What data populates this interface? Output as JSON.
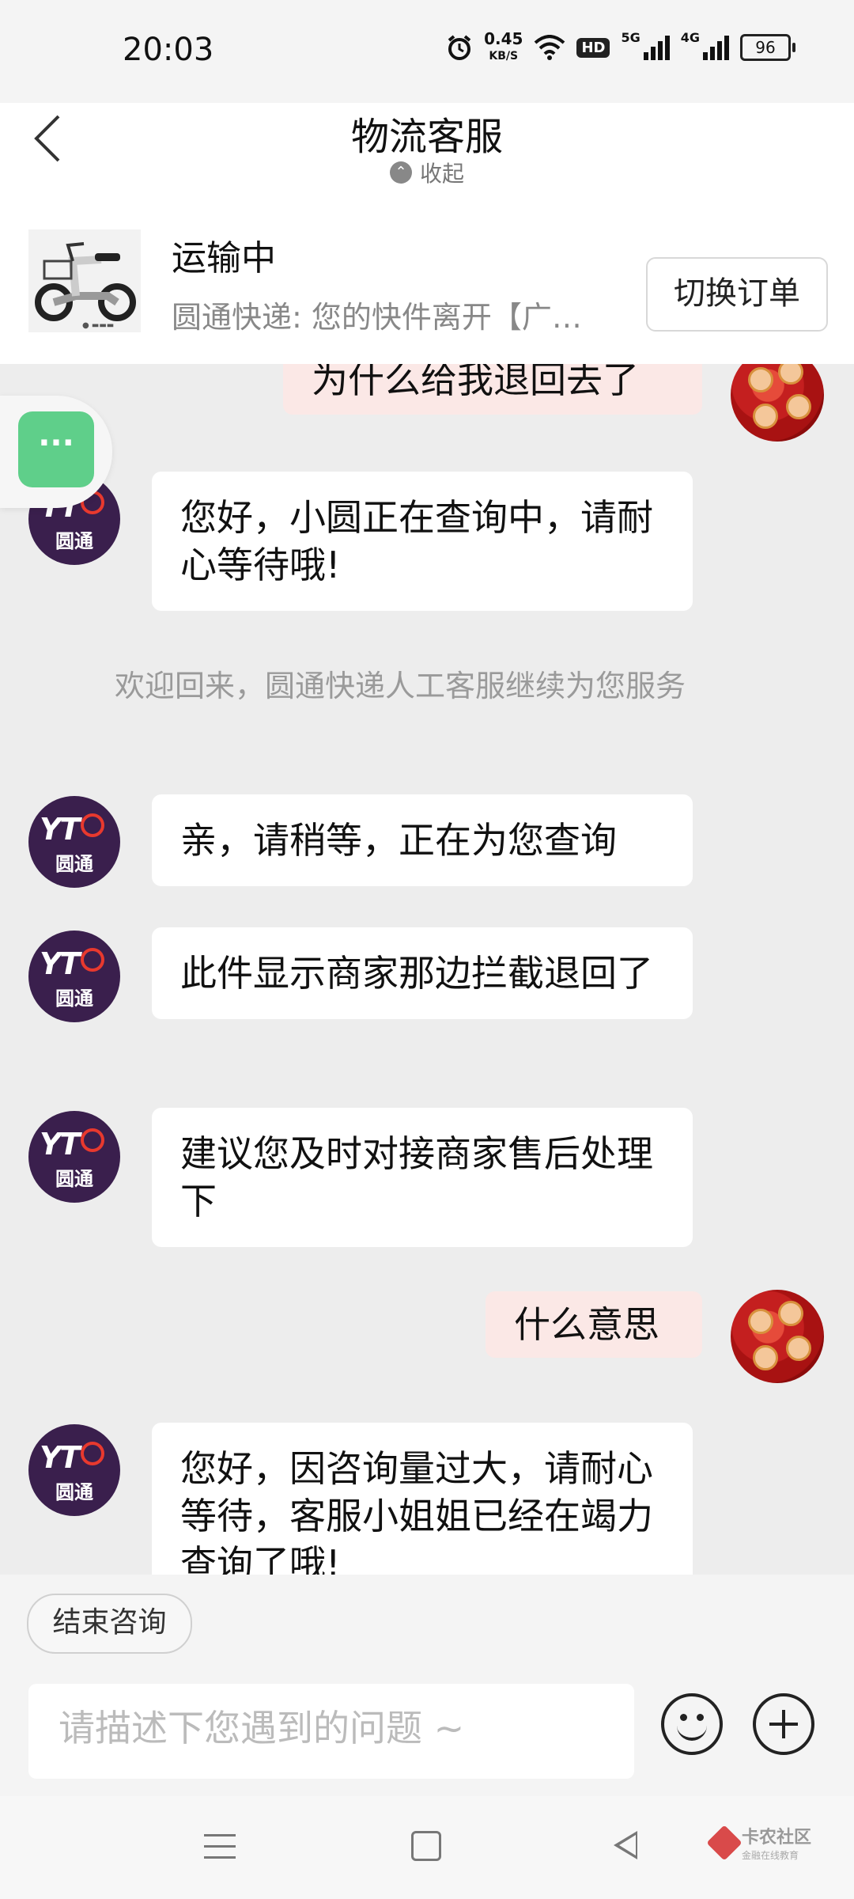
{
  "status_bar": {
    "time": "20:03",
    "net_speed_value": "0.45",
    "net_speed_unit": "KB/S",
    "hd_label": "HD",
    "sim1_label": "5G",
    "sim2_label": "4G",
    "battery": "96"
  },
  "header": {
    "title": "物流客服",
    "collapse_label": "收起"
  },
  "order": {
    "status": "运输中",
    "description": "圆通快递: 您的快件离开【广…",
    "switch_button": "切换订单"
  },
  "messages": [
    {
      "side": "right",
      "text": "为什么给我退回去了"
    },
    {
      "side": "left",
      "text": "您好，小圆正在查询中，请耐心等待哦!"
    },
    {
      "side": "system",
      "text": "欢迎回来，圆通快递人工客服继续为您服务"
    },
    {
      "side": "left",
      "text": "亲，请稍等，正在为您查询"
    },
    {
      "side": "left",
      "text": "此件显示商家那边拦截退回了"
    },
    {
      "side": "left",
      "text": "建议您及时对接商家售后处理下"
    },
    {
      "side": "right",
      "text": "什么意思"
    },
    {
      "side": "left",
      "text": "您好，因咨询量过大，请耐心等待，客服小姐姐已经在竭力查询了哦!"
    }
  ],
  "avatar_agent": {
    "logo": "YT",
    "name": "圆通"
  },
  "floating_menu": {
    "label": "···"
  },
  "bottom": {
    "end_button": "结束咨询",
    "input_placeholder": "请描述下您遇到的问题 ~"
  },
  "watermark": {
    "title": "卡农社区",
    "subtitle": "金融在线教育"
  },
  "icons": {
    "back": "chevron-left-icon",
    "collapse": "chevron-up-icon",
    "emoji": "smiley-icon",
    "plus": "plus-icon"
  },
  "colors": {
    "user_bubble": "#fbe8e6",
    "agent_bubble": "#ffffff",
    "chat_bg": "#ededed",
    "agent_avatar": "#3a1f4d",
    "float_button": "#5fcf8a"
  }
}
